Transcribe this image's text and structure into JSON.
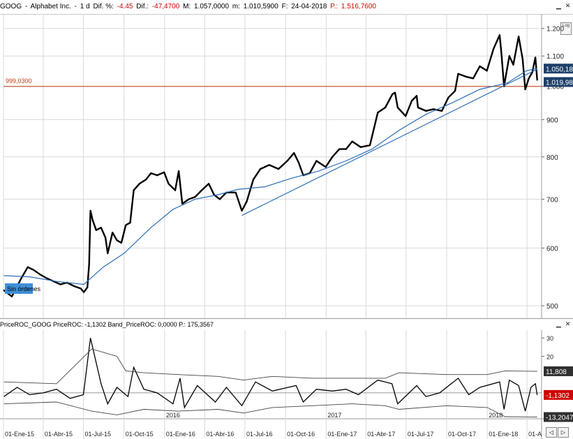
{
  "main_header": {
    "symbol": "GOOG",
    "name": "Alphabet Inc.",
    "period": "1 d",
    "dif_pct_label": "Dif. %:",
    "dif_pct": "-4.45",
    "dif_label": "Dif.:",
    "dif": "-47,4700",
    "max_label": "M:",
    "max": "1.057,0000",
    "min_label": "m:",
    "min": "1.010,5900",
    "date_label": "F:",
    "date": "24-04-2018",
    "p_label": "P.:",
    "p": "1.516,7600"
  },
  "roc_header": {
    "text": "PriceROC_GOOG PriceROC: -1,1302 Band_PriceROC: 0,0000 P.: 175,3567"
  },
  "order_label": "Sin órdenes",
  "log_button": "Log",
  "colors": {
    "price": "#000000",
    "moving_average": "#2a6cb5",
    "trendline": "#2a6cb5",
    "reference_line": "#c03a10",
    "last_price_tag": "#1c3f68",
    "roc_last_tag": "#d00000",
    "roc_band_tag": "#303030",
    "grid": "#d9d9d9"
  },
  "chart_data": [
    {
      "type": "line",
      "title": "GOOG · Alphabet Inc.",
      "y_scale": "log",
      "ylim": [
        485,
        1245
      ],
      "yticks": [
        "1.200",
        "1.100",
        "1.000",
        "900",
        "800",
        "700",
        "600",
        "500"
      ],
      "y_tick_values": [
        1200,
        1100,
        1000,
        900,
        800,
        700,
        600,
        500
      ],
      "reference_line": {
        "value": 999.03,
        "label": "999,0300"
      },
      "last_price_tags": [
        "1.050,180",
        "1.019,98"
      ],
      "last_price_tag_values": [
        1050.18,
        1019.98
      ],
      "series": [
        {
          "role": "price",
          "points": [
            [
              "2015-01-02",
              525
            ],
            [
              "2015-01-20",
              515
            ],
            [
              "2015-02-10",
              545
            ],
            [
              "2015-02-25",
              565
            ],
            [
              "2015-03-10",
              560
            ],
            [
              "2015-03-25",
              552
            ],
            [
              "2015-04-10",
              545
            ],
            [
              "2015-04-25",
              540
            ],
            [
              "2015-05-10",
              535
            ],
            [
              "2015-05-25",
              538
            ],
            [
              "2015-06-10",
              532
            ],
            [
              "2015-06-25",
              528
            ],
            [
              "2015-07-02",
              522
            ],
            [
              "2015-07-10",
              530
            ],
            [
              "2015-07-14",
              570
            ],
            [
              "2015-07-17",
              675
            ],
            [
              "2015-07-22",
              655
            ],
            [
              "2015-07-30",
              635
            ],
            [
              "2015-08-10",
              640
            ],
            [
              "2015-08-20",
              620
            ],
            [
              "2015-08-25",
              590
            ],
            [
              "2015-09-05",
              630
            ],
            [
              "2015-09-15",
              615
            ],
            [
              "2015-09-25",
              610
            ],
            [
              "2015-10-05",
              645
            ],
            [
              "2015-10-15",
              650
            ],
            [
              "2015-10-23",
              720
            ],
            [
              "2015-11-05",
              735
            ],
            [
              "2015-11-20",
              745
            ],
            [
              "2015-12-01",
              760
            ],
            [
              "2015-12-15",
              755
            ],
            [
              "2015-12-31",
              762
            ],
            [
              "2016-01-10",
              735
            ],
            [
              "2016-01-25",
              720
            ],
            [
              "2016-02-02",
              765
            ],
            [
              "2016-02-10",
              690
            ],
            [
              "2016-02-25",
              700
            ],
            [
              "2016-03-10",
              705
            ],
            [
              "2016-03-25",
              720
            ],
            [
              "2016-04-10",
              735
            ],
            [
              "2016-04-22",
              710
            ],
            [
              "2016-05-05",
              700
            ],
            [
              "2016-05-20",
              715
            ],
            [
              "2016-06-10",
              715
            ],
            [
              "2016-06-24",
              675
            ],
            [
              "2016-07-05",
              695
            ],
            [
              "2016-07-20",
              745
            ],
            [
              "2016-08-05",
              770
            ],
            [
              "2016-08-25",
              780
            ],
            [
              "2016-09-15",
              770
            ],
            [
              "2016-10-05",
              790
            ],
            [
              "2016-10-20",
              810
            ],
            [
              "2016-10-31",
              785
            ],
            [
              "2016-11-10",
              755
            ],
            [
              "2016-11-25",
              760
            ],
            [
              "2016-12-10",
              790
            ],
            [
              "2016-12-31",
              775
            ],
            [
              "2017-01-15",
              800
            ],
            [
              "2017-01-31",
              820
            ],
            [
              "2017-02-15",
              820
            ],
            [
              "2017-03-01",
              840
            ],
            [
              "2017-03-20",
              825
            ],
            [
              "2017-04-10",
              830
            ],
            [
              "2017-04-28",
              920
            ],
            [
              "2017-05-15",
              935
            ],
            [
              "2017-05-31",
              975
            ],
            [
              "2017-06-06",
              980
            ],
            [
              "2017-06-12",
              935
            ],
            [
              "2017-06-30",
              910
            ],
            [
              "2017-07-14",
              955
            ],
            [
              "2017-07-25",
              970
            ],
            [
              "2017-07-28",
              935
            ],
            [
              "2017-08-15",
              925
            ],
            [
              "2017-09-01",
              930
            ],
            [
              "2017-09-20",
              925
            ],
            [
              "2017-10-05",
              965
            ],
            [
              "2017-10-20",
              985
            ],
            [
              "2017-10-27",
              1040
            ],
            [
              "2017-11-15",
              1030
            ],
            [
              "2017-11-30",
              1025
            ],
            [
              "2017-12-15",
              1065
            ],
            [
              "2017-12-31",
              1050
            ],
            [
              "2018-01-15",
              1125
            ],
            [
              "2018-01-29",
              1175
            ],
            [
              "2018-02-02",
              1110
            ],
            [
              "2018-02-08",
              1000
            ],
            [
              "2018-02-20",
              1100
            ],
            [
              "2018-03-01",
              1070
            ],
            [
              "2018-03-13",
              1170
            ],
            [
              "2018-03-22",
              1090
            ],
            [
              "2018-03-28",
              990
            ],
            [
              "2018-04-05",
              1025
            ],
            [
              "2018-04-13",
              1045
            ],
            [
              "2018-04-20",
              1095
            ],
            [
              "2018-04-24",
              1020
            ]
          ]
        },
        {
          "role": "moving_average",
          "points": [
            [
              "2015-01-02",
              550
            ],
            [
              "2015-03-01",
              548
            ],
            [
              "2015-05-01",
              540
            ],
            [
              "2015-07-02",
              535
            ],
            [
              "2015-08-15",
              565
            ],
            [
              "2015-10-01",
              590
            ],
            [
              "2015-12-01",
              640
            ],
            [
              "2016-01-20",
              678
            ],
            [
              "2016-03-10",
              700
            ],
            [
              "2016-05-01",
              710
            ],
            [
              "2016-06-15",
              722
            ],
            [
              "2016-08-15",
              728
            ],
            [
              "2016-10-15",
              748
            ],
            [
              "2016-12-15",
              765
            ],
            [
              "2017-02-15",
              790
            ],
            [
              "2017-04-15",
              820
            ],
            [
              "2017-06-15",
              870
            ],
            [
              "2017-08-15",
              915
            ],
            [
              "2017-10-15",
              950
            ],
            [
              "2017-12-15",
              990
            ],
            [
              "2018-02-15",
              1010
            ],
            [
              "2018-03-31",
              1050
            ],
            [
              "2018-04-24",
              1058
            ]
          ]
        },
        {
          "role": "trendline",
          "points": [
            [
              "2016-06-24",
              665
            ],
            [
              "2018-04-24",
              1055
            ]
          ]
        }
      ]
    },
    {
      "type": "line",
      "title": "PriceROC_GOOG",
      "ylim": [
        -13,
        32
      ],
      "yticks": [
        "30",
        "20"
      ],
      "y_tick_values": [
        30,
        20
      ],
      "value_tags": [
        "11,808",
        "-1,1302",
        "-13,2047"
      ],
      "value_tag_values": [
        11.808,
        -1.1302,
        -13.2047
      ],
      "series": [
        {
          "role": "price_roc",
          "points": [
            [
              "2015-01-02",
              -2
            ],
            [
              "2015-02-01",
              3
            ],
            [
              "2015-03-01",
              -1
            ],
            [
              "2015-04-01",
              0
            ],
            [
              "2015-05-01",
              2
            ],
            [
              "2015-06-01",
              -3
            ],
            [
              "2015-07-01",
              -1
            ],
            [
              "2015-07-17",
              30
            ],
            [
              "2015-08-10",
              5
            ],
            [
              "2015-08-25",
              -6
            ],
            [
              "2015-09-15",
              3
            ],
            [
              "2015-10-10",
              -2
            ],
            [
              "2015-10-23",
              14
            ],
            [
              "2015-11-15",
              2
            ],
            [
              "2015-12-15",
              0
            ],
            [
              "2016-01-20",
              -6
            ],
            [
              "2016-02-05",
              8
            ],
            [
              "2016-02-15",
              -8
            ],
            [
              "2016-03-15",
              4
            ],
            [
              "2016-04-25",
              -5
            ],
            [
              "2016-05-20",
              3
            ],
            [
              "2016-06-24",
              -7
            ],
            [
              "2016-07-25",
              6
            ],
            [
              "2016-09-01",
              1
            ],
            [
              "2016-10-25",
              4
            ],
            [
              "2016-11-10",
              -5
            ],
            [
              "2016-12-10",
              2
            ],
            [
              "2017-01-15",
              1
            ],
            [
              "2017-02-15",
              2
            ],
            [
              "2017-03-15",
              -1
            ],
            [
              "2017-04-28",
              7
            ],
            [
              "2017-05-30",
              5
            ],
            [
              "2017-06-12",
              -6
            ],
            [
              "2017-07-25",
              4
            ],
            [
              "2017-08-15",
              -2
            ],
            [
              "2017-09-15",
              0
            ],
            [
              "2017-10-27",
              8
            ],
            [
              "2017-11-20",
              -1
            ],
            [
              "2017-12-15",
              3
            ],
            [
              "2018-01-29",
              6
            ],
            [
              "2018-02-08",
              -9
            ],
            [
              "2018-02-20",
              7
            ],
            [
              "2018-03-13",
              4
            ],
            [
              "2018-03-28",
              -10
            ],
            [
              "2018-04-10",
              3
            ],
            [
              "2018-04-20",
              5
            ],
            [
              "2018-04-24",
              -1.13
            ]
          ]
        },
        {
          "role": "upper_band",
          "points": [
            [
              "2015-01-02",
              6
            ],
            [
              "2015-05-01",
              5
            ],
            [
              "2015-07-20",
              24
            ],
            [
              "2015-09-15",
              20
            ],
            [
              "2015-10-05",
              12
            ],
            [
              "2015-11-15",
              11
            ],
            [
              "2016-02-01",
              10
            ],
            [
              "2016-05-01",
              9
            ],
            [
              "2016-06-28",
              7
            ],
            [
              "2016-09-01",
              9
            ],
            [
              "2016-12-01",
              8
            ],
            [
              "2017-03-01",
              8
            ],
            [
              "2017-05-15",
              8
            ],
            [
              "2017-06-15",
              11
            ],
            [
              "2017-10-01",
              10
            ],
            [
              "2018-01-01",
              10
            ],
            [
              "2018-02-10",
              12
            ],
            [
              "2018-04-24",
              11.8
            ]
          ]
        },
        {
          "role": "lower_band",
          "points": [
            [
              "2015-01-02",
              -6
            ],
            [
              "2015-05-01",
              -5
            ],
            [
              "2015-07-20",
              -10
            ],
            [
              "2015-09-15",
              -12
            ],
            [
              "2015-10-05",
              -11
            ],
            [
              "2015-11-15",
              -9
            ],
            [
              "2016-02-01",
              -10
            ],
            [
              "2016-05-01",
              -9
            ],
            [
              "2016-06-28",
              -11
            ],
            [
              "2016-09-01",
              -8
            ],
            [
              "2016-12-01",
              -7
            ],
            [
              "2017-03-01",
              -6
            ],
            [
              "2017-05-15",
              -7
            ],
            [
              "2017-06-15",
              -9
            ],
            [
              "2017-10-01",
              -7
            ],
            [
              "2018-01-01",
              -8
            ],
            [
              "2018-02-10",
              -13
            ],
            [
              "2018-04-24",
              -13.2
            ]
          ]
        }
      ]
    }
  ],
  "x_axis": {
    "ticks": [
      {
        "label": "01-Ene-15",
        "date": "2015-01-01"
      },
      {
        "label": "01-Abr-15",
        "date": "2015-04-01"
      },
      {
        "label": "01-Jul-15",
        "date": "2015-07-01"
      },
      {
        "label": "01-Oct-15",
        "date": "2015-10-01"
      },
      {
        "label": "01-Ene-16",
        "date": "2016-01-01"
      },
      {
        "label": "01-Abr-16",
        "date": "2016-04-01"
      },
      {
        "label": "01-Jul-16",
        "date": "2016-07-01"
      },
      {
        "label": "01-Oct-16",
        "date": "2016-10-01"
      },
      {
        "label": "01-Ene-17",
        "date": "2017-01-01"
      },
      {
        "label": "01-Abr-17",
        "date": "2017-04-01"
      },
      {
        "label": "01-Jul-17",
        "date": "2017-07-01"
      },
      {
        "label": "01-Oct-17",
        "date": "2017-10-01"
      },
      {
        "label": "01-Ene-18",
        "date": "2018-01-01"
      },
      {
        "label": "01-A",
        "date": "2018-04-01"
      }
    ],
    "year_labels": [
      {
        "label": "2016",
        "date": "2016-01-01"
      },
      {
        "label": "2017",
        "date": "2017-01-01"
      },
      {
        "label": "2018",
        "date": "2018-01-01"
      }
    ],
    "range": [
      "2015-01-01",
      "2018-05-04"
    ]
  }
}
